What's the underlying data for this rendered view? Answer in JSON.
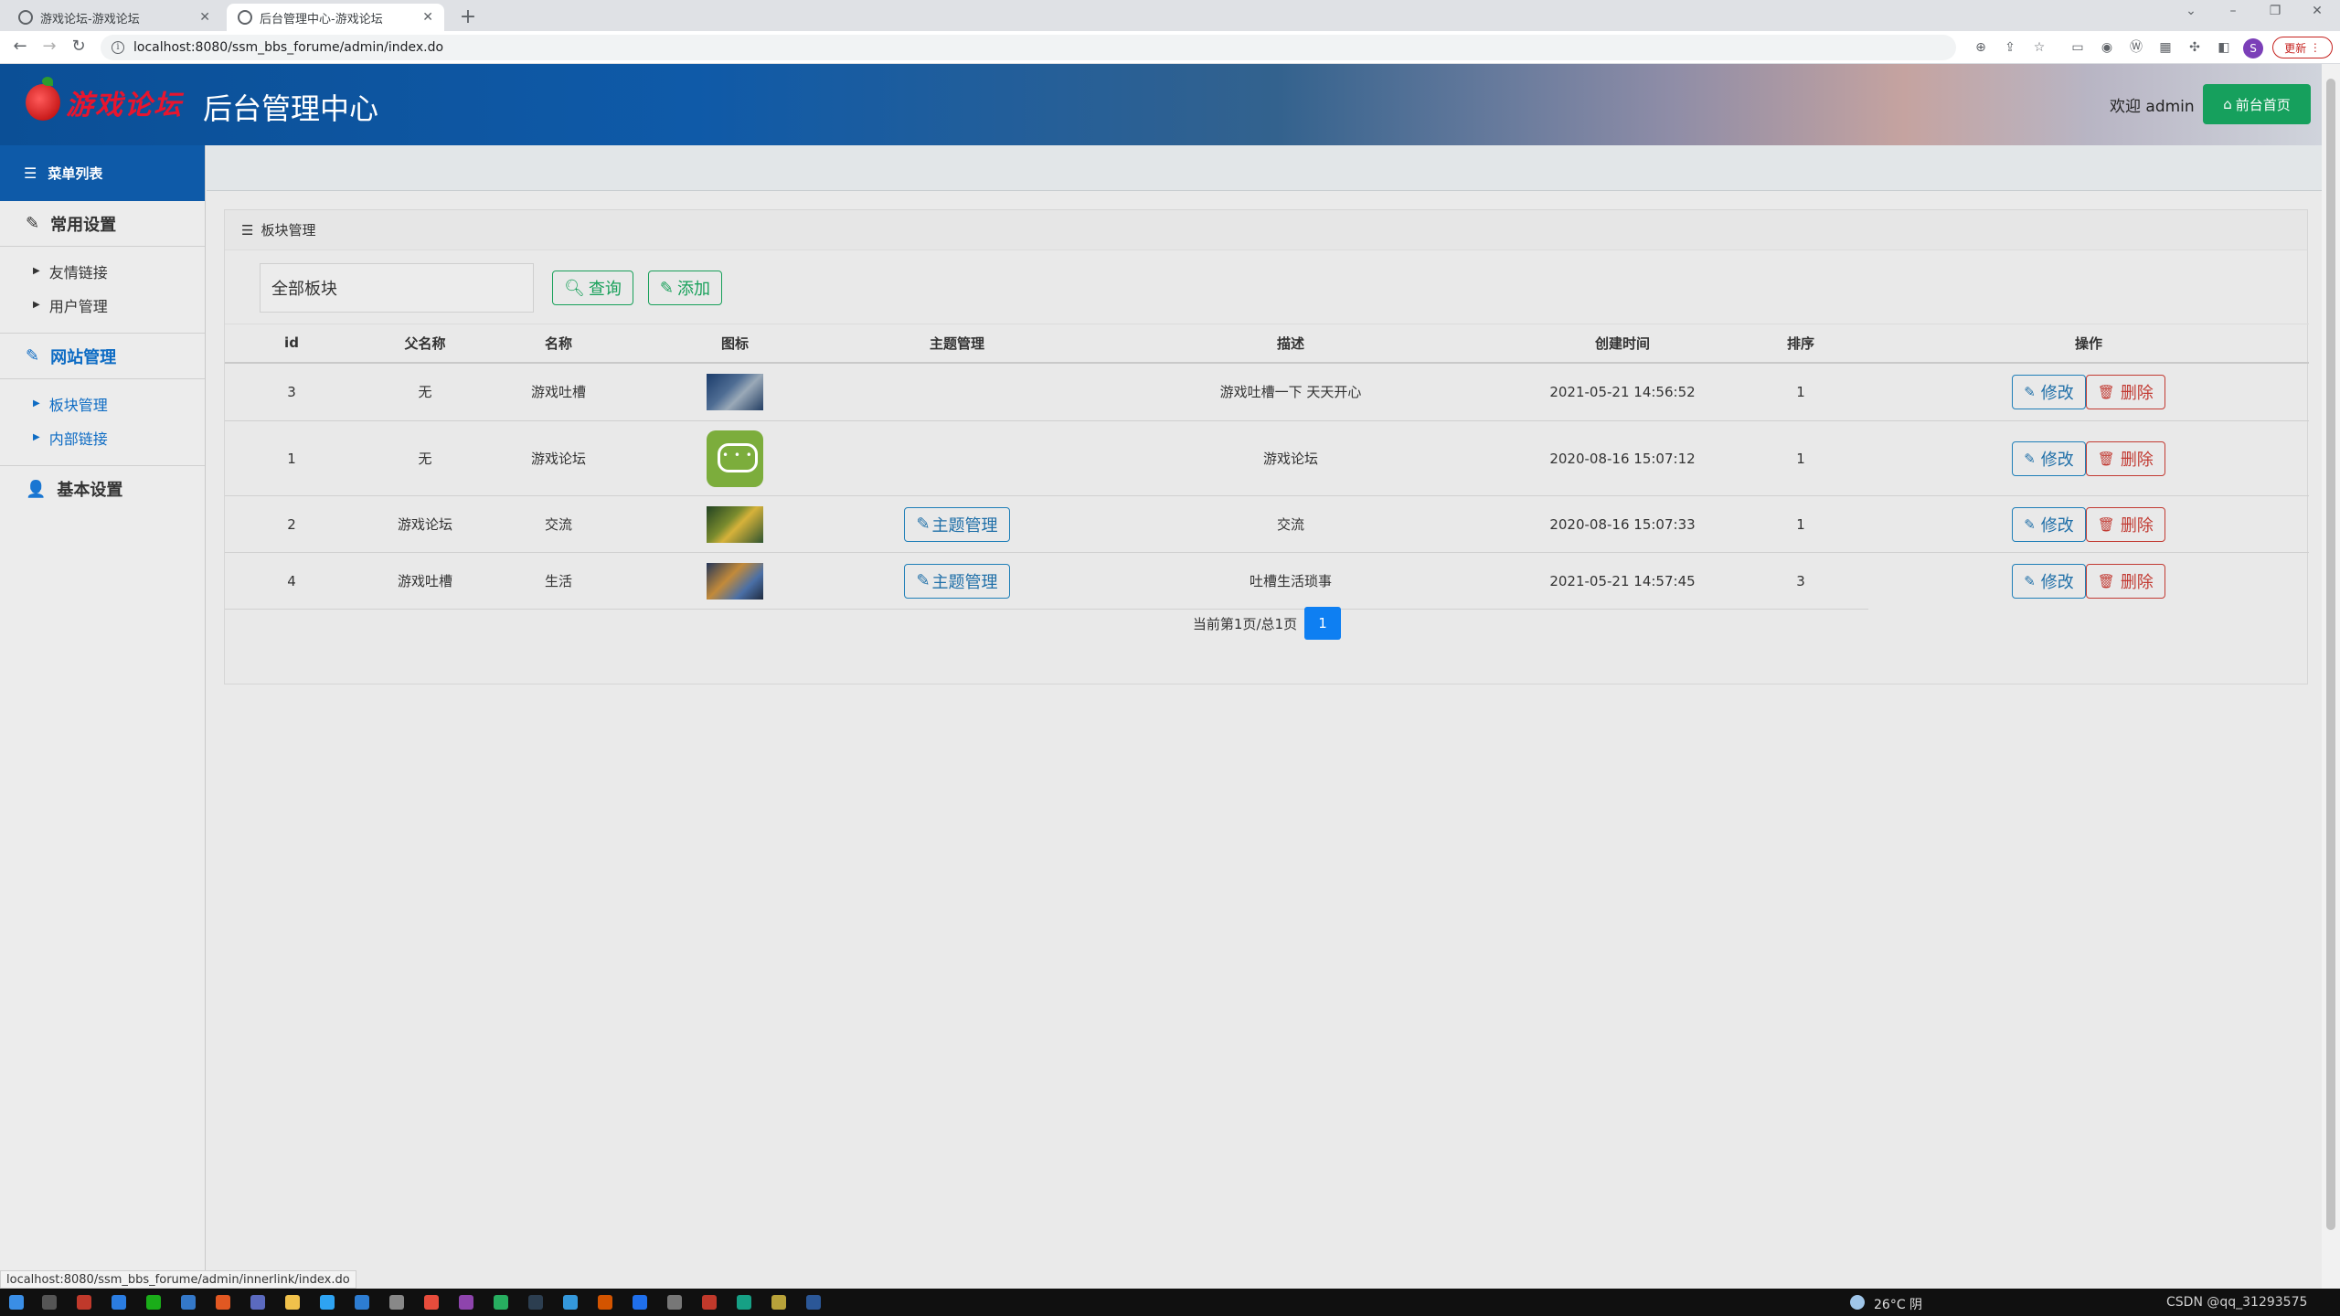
{
  "browser": {
    "tabs": [
      {
        "title": "游戏论坛-游戏论坛",
        "active": false
      },
      {
        "title": "后台管理中心-游戏论坛",
        "active": true
      }
    ],
    "url": "localhost:8080/ssm_bbs_forume/admin/index.do",
    "update_label": "更新",
    "profile_initial": "S"
  },
  "header": {
    "logo_text": "游戏论坛",
    "title": "后台管理中心",
    "welcome": "欢迎 admin",
    "front_button": "前台首页"
  },
  "sidebar": {
    "menu_title": "菜单列表",
    "groups": [
      {
        "title": "常用设置",
        "icon": "edit-icon",
        "items": [
          "友情链接",
          "用户管理"
        ]
      },
      {
        "title": "网站管理",
        "icon": "edit-icon",
        "items": [
          "板块管理",
          "内部链接"
        ]
      },
      {
        "title": "基本设置",
        "icon": "user-icon",
        "items": []
      }
    ]
  },
  "panel": {
    "title": "板块管理",
    "filter_value": "全部板块",
    "query_button": "查询",
    "add_button": "添加"
  },
  "table": {
    "headers": [
      "id",
      "父名称",
      "名称",
      "图标",
      "主题管理",
      "描述",
      "创建时间",
      "排序",
      "操作"
    ],
    "rows": [
      {
        "id": "3",
        "parent": "无",
        "name": "游戏吐槽",
        "icon": "image-thumbnail",
        "topic_button": "",
        "desc": "游戏吐槽一下 天天开心",
        "created": "2021-05-21 14:56:52",
        "sort": "1"
      },
      {
        "id": "1",
        "parent": "无",
        "name": "游戏论坛",
        "icon": "chat-icon",
        "topic_button": "",
        "desc": "游戏论坛",
        "created": "2020-08-16 15:07:12",
        "sort": "1"
      },
      {
        "id": "2",
        "parent": "游戏论坛",
        "name": "交流",
        "icon": "image-thumbnail",
        "topic_button": "主题管理",
        "desc": "交流",
        "created": "2020-08-16 15:07:33",
        "sort": "1"
      },
      {
        "id": "4",
        "parent": "游戏吐槽",
        "name": "生活",
        "icon": "image-thumbnail",
        "topic_button": "主题管理",
        "desc": "吐槽生活琐事",
        "created": "2021-05-21 14:57:45",
        "sort": "3"
      }
    ],
    "edit_label": "修改",
    "delete_label": "删除"
  },
  "pager": {
    "info": "当前第1页/总1页",
    "current_page": "1"
  },
  "status_url": "localhost:8080/ssm_bbs_forume/admin/innerlink/index.do",
  "taskbar": {
    "weather": "26°C 阴",
    "watermark": "CSDN @qq_31293575"
  },
  "colors": {
    "header_blue": "#0e5aa8",
    "success_green": "#16a05d",
    "primary_blue": "#1f6fa8",
    "danger_red": "#c23b33",
    "page_active": "#0e7ff2"
  }
}
